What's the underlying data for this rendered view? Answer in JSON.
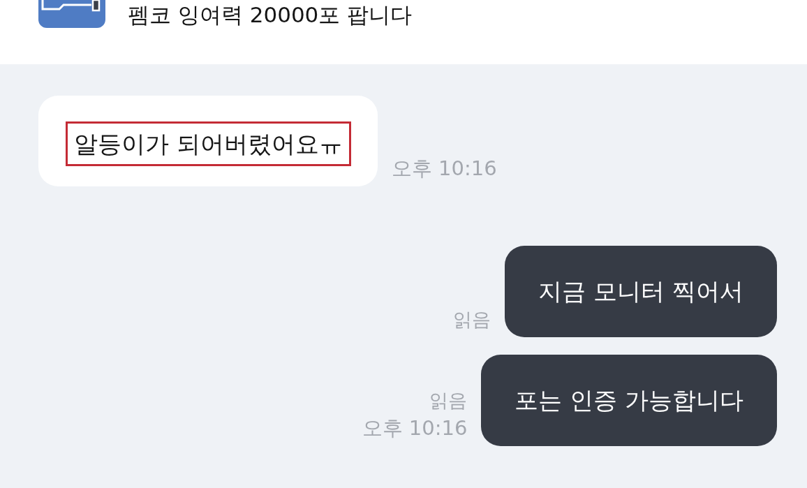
{
  "header": {
    "title": "펨코 잉여력 20000포 팝니다"
  },
  "messages": [
    {
      "kind": "received",
      "text": "알등이가 되어버렸어요ㅠ",
      "highlighted": true,
      "time": "오후 10:16"
    },
    {
      "kind": "sent",
      "text": "지금 모니터 찍어서",
      "highlighted": false,
      "receipt": "읽음"
    },
    {
      "kind": "sent",
      "text": "포는 인증 가능합니다",
      "highlighted": false,
      "receipt": "읽음",
      "time": "오후 10:16"
    }
  ]
}
